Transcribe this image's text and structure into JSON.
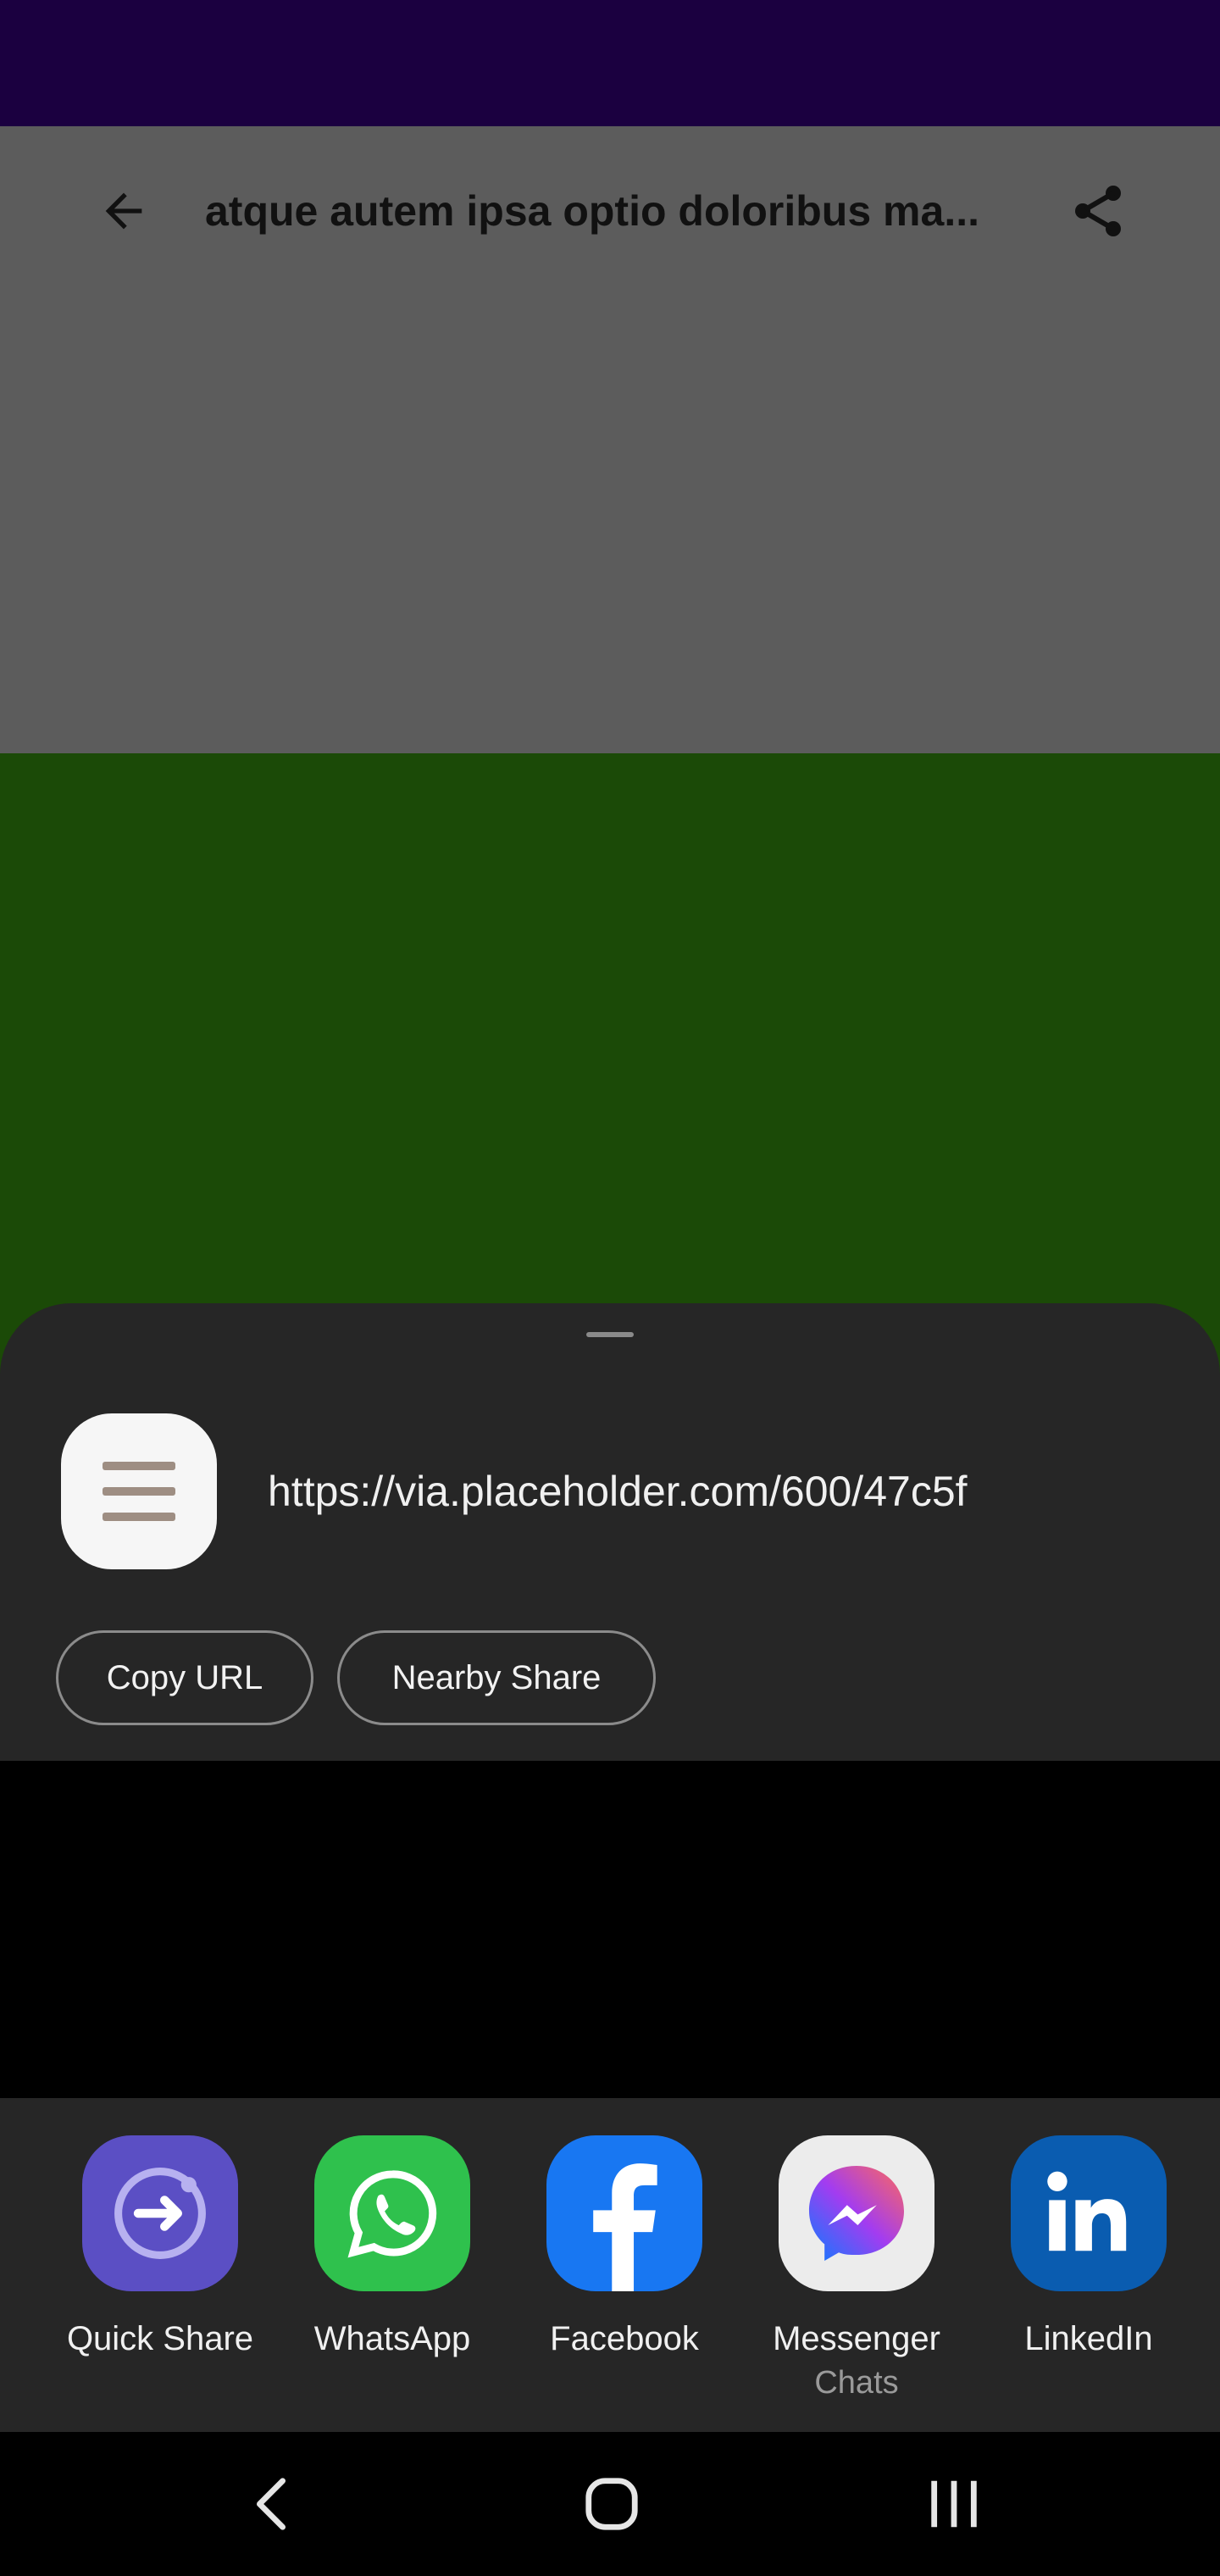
{
  "app_bar": {
    "title": "atque autem ipsa optio doloribus ma...",
    "back_icon": "arrow-left-icon",
    "share_icon": "share-icon"
  },
  "share_sheet": {
    "preview_icon": "document-lines-icon",
    "url": "https://via.placeholder.com/600/47c5f",
    "copy_url_label": "Copy URL",
    "nearby_share_label": "Nearby Share",
    "apps": [
      {
        "label": "Quick Share",
        "sub": "",
        "icon": "quick-share-icon",
        "color": "#5b4fc4"
      },
      {
        "label": "WhatsApp",
        "sub": "",
        "icon": "whatsapp-icon",
        "color": "#2fc14d"
      },
      {
        "label": "Facebook",
        "sub": "",
        "icon": "facebook-icon",
        "color": "#1877f2"
      },
      {
        "label": "Messenger",
        "sub": "Chats",
        "icon": "messenger-icon",
        "color": "#ececec"
      },
      {
        "label": "LinkedIn",
        "sub": "",
        "icon": "linkedin-icon",
        "color": "#0a5cb0"
      }
    ]
  },
  "nav_bar": {
    "back_icon": "nav-back-icon",
    "home_icon": "nav-home-icon",
    "recents_icon": "nav-recents-icon"
  },
  "colors": {
    "status_bar": "#1b0040",
    "app_bar": "#5c5c5c",
    "image_area": "#1b4a07",
    "sheet": "#262626"
  }
}
